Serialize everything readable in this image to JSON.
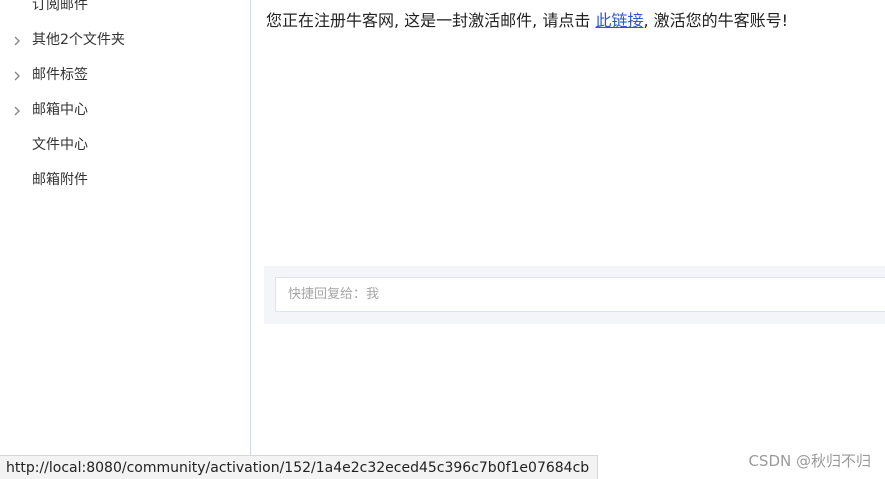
{
  "sidebar": {
    "items": [
      {
        "label": "订阅邮件",
        "expandable": false
      },
      {
        "label": "其他2个文件夹",
        "expandable": true
      },
      {
        "label": "邮件标签",
        "expandable": true
      },
      {
        "label": "邮箱中心",
        "expandable": true
      },
      {
        "label": "文件中心",
        "expandable": false
      },
      {
        "label": "邮箱附件",
        "expandable": false
      }
    ]
  },
  "mail": {
    "text_before": "您正在注册牛客网, 这是一封激活邮件, 请点击 ",
    "link_text": "此链接",
    "text_after": ", 激活您的牛客账号!"
  },
  "reply": {
    "placeholder": "快捷回复给：我"
  },
  "status_bar": {
    "url": "http://local:8080/community/activation/152/1a4e2c32eced45c396c7b0f1e07684cb"
  },
  "watermark": {
    "text": "CSDN @秋归不归"
  },
  "colors": {
    "link": "#2a55d6",
    "sidebar_border": "#cfd8e6",
    "reply_panel_bg": "#f3f5f9"
  }
}
